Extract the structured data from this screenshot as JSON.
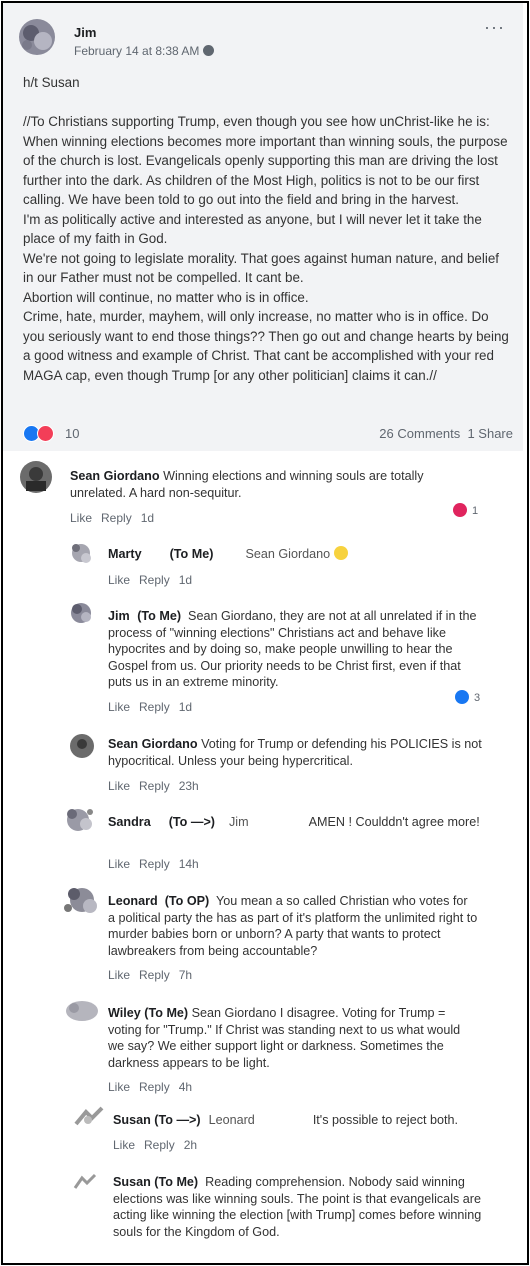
{
  "post": {
    "author": "Jim",
    "date": "February 14 at 8:38 AM",
    "more_icon": "···",
    "text": "h/t Susan\n\n//To Christians supporting Trump, even though you see how unChrist-like he is:\nWhen winning elections becomes more important than winning souls, the purpose of the church is lost. Evangelicals openly supporting this man are driving the lost further into the dark. As children of the Most High, politics is not to be our first calling. We have been told to go out into the field and bring in the harvest.\nI'm as politically active and interested as anyone, but I will never let it take the place of my faith in God.\nWe're not going to legislate morality. That goes against human nature, and belief in our Father must not be compelled. It cant be.\nAbortion will continue, no matter who is in office.\nCrime, hate, murder, mayhem, will only increase, no matter who is in office. Do you seriously want to end those things?? Then go out and change hearts by being a good witness and example of Christ. That cant be accomplished with your red MAGA cap, even though Trump [or any other politician] claims it can.//",
    "reaction_count": "10",
    "comments_count": "26 Comments",
    "shares_count": "1 Share"
  },
  "actions": {
    "like": "Like",
    "reply": "Reply"
  },
  "comments": [
    {
      "name": "Sean Giordano",
      "tag": "",
      "text": "Winning elections and winning souls are totally unrelated. A hard non-sequitur.",
      "time": "1d",
      "reactions": "1"
    },
    {
      "name": "Marty",
      "tag": "(To Me)",
      "text": "Sean Giordano",
      "time": "1d",
      "reactions": ""
    },
    {
      "name": "Jim",
      "tag": "(To Me)",
      "text": "Sean Giordano, they are not at all unrelated if in the process of \"winning elections\" Christians act and behave like hypocrites and by doing so, make people unwilling to hear the Gospel from us. Our priority needs to be Christ first, even if that puts us in an extreme minority.",
      "time": "1d",
      "reactions": "3"
    },
    {
      "name": "Sean Giordano",
      "tag": "",
      "text": "Voting for Trump or defending his POLICIES is not hypocritical. Unless your being hypercritical.",
      "time": "23h",
      "reactions": ""
    },
    {
      "name": "Sandra",
      "tag": "(To —>)",
      "mention": "Jim",
      "text": "AMEN ! Coulddn't agree more!",
      "time": "14h",
      "reactions": ""
    },
    {
      "name": "Leonard",
      "tag": "(To OP)",
      "text": "You mean a so called Christian who votes for a political party the has as part of it's platform the unlimited right to murder babies born or unborn? A party that wants to protect lawbreakers from being accountable?",
      "time": "7h",
      "reactions": ""
    },
    {
      "name": "Wiley",
      "tag": "(To Me)",
      "text": "Sean Giordano I disagree. Voting for Trump = voting for \"Trump.\" If Christ was standing next to us what would we say? We either support light or darkness. Sometimes the darkness appears to be light.",
      "time": "4h",
      "reactions": ""
    },
    {
      "name": "Susan",
      "tag": "(To —>)",
      "mention": "Leonard",
      "text": "It's possible to reject both.",
      "time": "2h",
      "reactions": ""
    },
    {
      "name": "Susan",
      "tag": "(To Me)",
      "text": "Reading comprehension. Nobody said winning elections was like winning souls. The point is that evangelicals are acting like winning the election [with Trump] comes before winning souls for the Kingdom of God.",
      "time": "",
      "reactions": ""
    }
  ]
}
